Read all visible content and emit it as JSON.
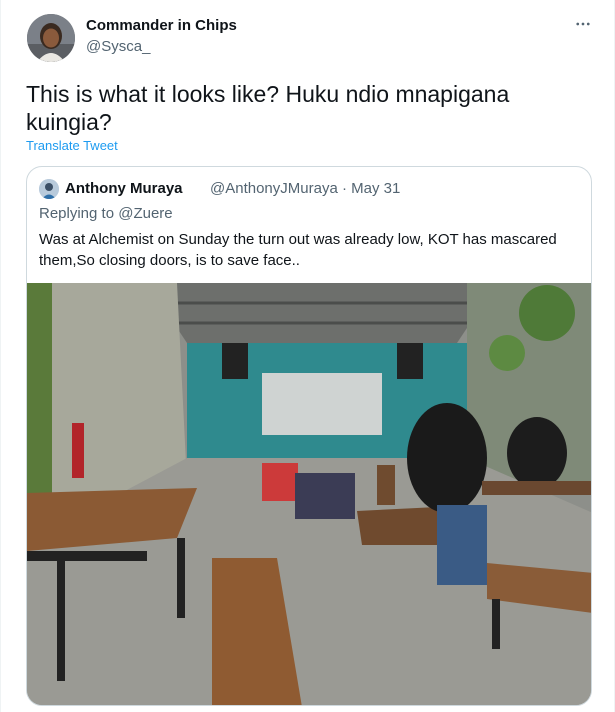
{
  "tweet": {
    "author_name": "Commander in Chips",
    "author_handle": "@Sysca_",
    "text": "This is what it looks like? Huku ndio mnapigana kuingia?",
    "translate_label": "Translate Tweet",
    "more_icon": "more-horizontal-icon"
  },
  "quoted": {
    "author_name": "Anthony Muraya",
    "author_handle": "@AnthonyJMuraya · May 31",
    "replying_prefix": "Replying to",
    "replying_to": "@Zuere",
    "text": "Was at Alchemist on Sunday the turn out was already low, KOT has mascared them,So closing doors, is to save face..",
    "photo_icon": "photo-icon"
  },
  "colors": {
    "link": "#1d9bf0",
    "secondary_text": "#536471",
    "border": "#cfd9de"
  }
}
